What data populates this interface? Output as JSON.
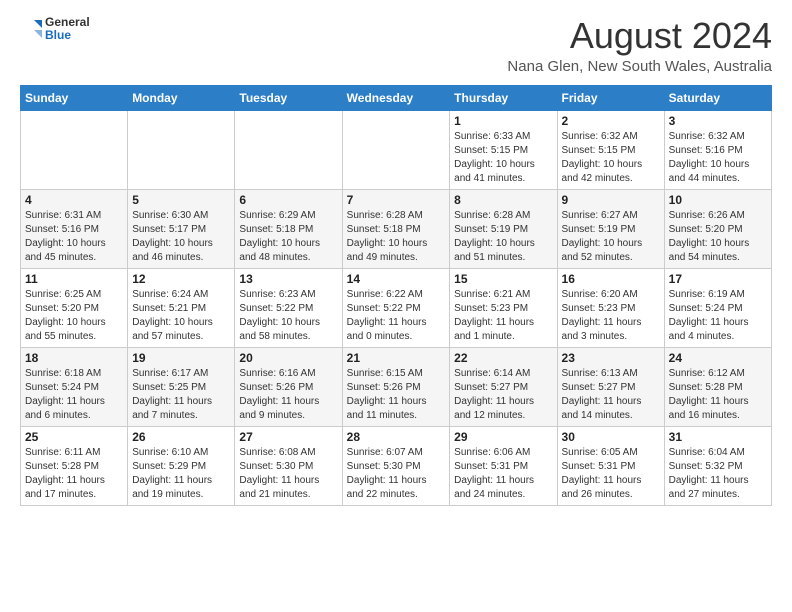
{
  "header": {
    "logo_line1": "General",
    "logo_line2": "Blue",
    "month_year": "August 2024",
    "location": "Nana Glen, New South Wales, Australia"
  },
  "days_of_week": [
    "Sunday",
    "Monday",
    "Tuesday",
    "Wednesday",
    "Thursday",
    "Friday",
    "Saturday"
  ],
  "weeks": [
    [
      {
        "day": "",
        "info": ""
      },
      {
        "day": "",
        "info": ""
      },
      {
        "day": "",
        "info": ""
      },
      {
        "day": "",
        "info": ""
      },
      {
        "day": "1",
        "info": "Sunrise: 6:33 AM\nSunset: 5:15 PM\nDaylight: 10 hours\nand 41 minutes."
      },
      {
        "day": "2",
        "info": "Sunrise: 6:32 AM\nSunset: 5:15 PM\nDaylight: 10 hours\nand 42 minutes."
      },
      {
        "day": "3",
        "info": "Sunrise: 6:32 AM\nSunset: 5:16 PM\nDaylight: 10 hours\nand 44 minutes."
      }
    ],
    [
      {
        "day": "4",
        "info": "Sunrise: 6:31 AM\nSunset: 5:16 PM\nDaylight: 10 hours\nand 45 minutes."
      },
      {
        "day": "5",
        "info": "Sunrise: 6:30 AM\nSunset: 5:17 PM\nDaylight: 10 hours\nand 46 minutes."
      },
      {
        "day": "6",
        "info": "Sunrise: 6:29 AM\nSunset: 5:18 PM\nDaylight: 10 hours\nand 48 minutes."
      },
      {
        "day": "7",
        "info": "Sunrise: 6:28 AM\nSunset: 5:18 PM\nDaylight: 10 hours\nand 49 minutes."
      },
      {
        "day": "8",
        "info": "Sunrise: 6:28 AM\nSunset: 5:19 PM\nDaylight: 10 hours\nand 51 minutes."
      },
      {
        "day": "9",
        "info": "Sunrise: 6:27 AM\nSunset: 5:19 PM\nDaylight: 10 hours\nand 52 minutes."
      },
      {
        "day": "10",
        "info": "Sunrise: 6:26 AM\nSunset: 5:20 PM\nDaylight: 10 hours\nand 54 minutes."
      }
    ],
    [
      {
        "day": "11",
        "info": "Sunrise: 6:25 AM\nSunset: 5:20 PM\nDaylight: 10 hours\nand 55 minutes."
      },
      {
        "day": "12",
        "info": "Sunrise: 6:24 AM\nSunset: 5:21 PM\nDaylight: 10 hours\nand 57 minutes."
      },
      {
        "day": "13",
        "info": "Sunrise: 6:23 AM\nSunset: 5:22 PM\nDaylight: 10 hours\nand 58 minutes."
      },
      {
        "day": "14",
        "info": "Sunrise: 6:22 AM\nSunset: 5:22 PM\nDaylight: 11 hours\nand 0 minutes."
      },
      {
        "day": "15",
        "info": "Sunrise: 6:21 AM\nSunset: 5:23 PM\nDaylight: 11 hours\nand 1 minute."
      },
      {
        "day": "16",
        "info": "Sunrise: 6:20 AM\nSunset: 5:23 PM\nDaylight: 11 hours\nand 3 minutes."
      },
      {
        "day": "17",
        "info": "Sunrise: 6:19 AM\nSunset: 5:24 PM\nDaylight: 11 hours\nand 4 minutes."
      }
    ],
    [
      {
        "day": "18",
        "info": "Sunrise: 6:18 AM\nSunset: 5:24 PM\nDaylight: 11 hours\nand 6 minutes."
      },
      {
        "day": "19",
        "info": "Sunrise: 6:17 AM\nSunset: 5:25 PM\nDaylight: 11 hours\nand 7 minutes."
      },
      {
        "day": "20",
        "info": "Sunrise: 6:16 AM\nSunset: 5:26 PM\nDaylight: 11 hours\nand 9 minutes."
      },
      {
        "day": "21",
        "info": "Sunrise: 6:15 AM\nSunset: 5:26 PM\nDaylight: 11 hours\nand 11 minutes."
      },
      {
        "day": "22",
        "info": "Sunrise: 6:14 AM\nSunset: 5:27 PM\nDaylight: 11 hours\nand 12 minutes."
      },
      {
        "day": "23",
        "info": "Sunrise: 6:13 AM\nSunset: 5:27 PM\nDaylight: 11 hours\nand 14 minutes."
      },
      {
        "day": "24",
        "info": "Sunrise: 6:12 AM\nSunset: 5:28 PM\nDaylight: 11 hours\nand 16 minutes."
      }
    ],
    [
      {
        "day": "25",
        "info": "Sunrise: 6:11 AM\nSunset: 5:28 PM\nDaylight: 11 hours\nand 17 minutes."
      },
      {
        "day": "26",
        "info": "Sunrise: 6:10 AM\nSunset: 5:29 PM\nDaylight: 11 hours\nand 19 minutes."
      },
      {
        "day": "27",
        "info": "Sunrise: 6:08 AM\nSunset: 5:30 PM\nDaylight: 11 hours\nand 21 minutes."
      },
      {
        "day": "28",
        "info": "Sunrise: 6:07 AM\nSunset: 5:30 PM\nDaylight: 11 hours\nand 22 minutes."
      },
      {
        "day": "29",
        "info": "Sunrise: 6:06 AM\nSunset: 5:31 PM\nDaylight: 11 hours\nand 24 minutes."
      },
      {
        "day": "30",
        "info": "Sunrise: 6:05 AM\nSunset: 5:31 PM\nDaylight: 11 hours\nand 26 minutes."
      },
      {
        "day": "31",
        "info": "Sunrise: 6:04 AM\nSunset: 5:32 PM\nDaylight: 11 hours\nand 27 minutes."
      }
    ]
  ]
}
